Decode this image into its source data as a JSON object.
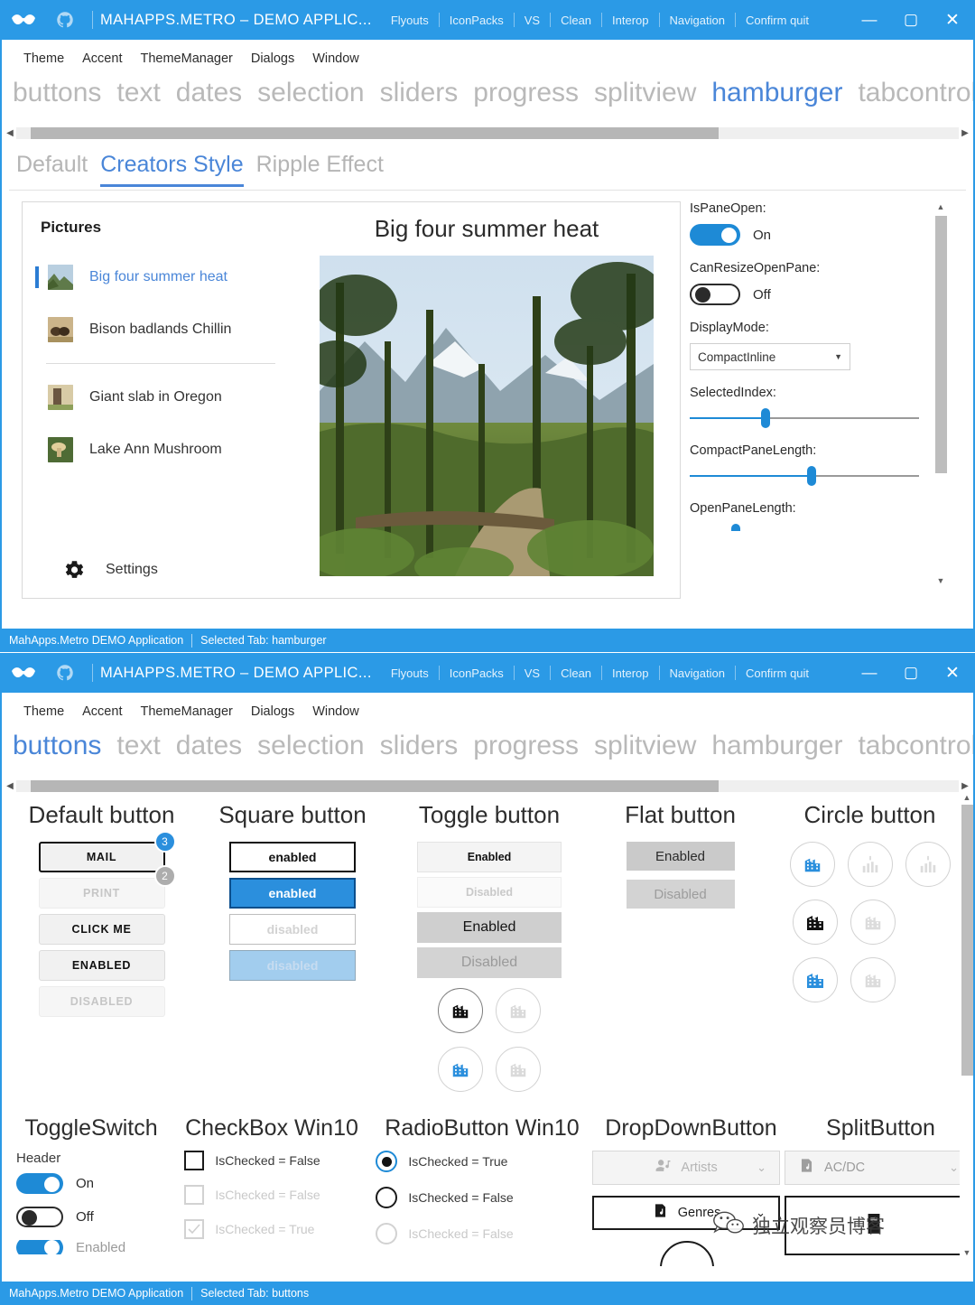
{
  "accent": "#2b9ae6",
  "accent_dark": "#2b7cd3",
  "windows": [
    {
      "titlebar": {
        "logo_icon": "mahapps-mustache-icon",
        "github_icon": "github-octocat-icon",
        "title": "MAHAPPS.METRO – DEMO APPLIC...",
        "menus": [
          "Flyouts",
          "IconPacks",
          "VS",
          "Clean",
          "Interop",
          "Navigation",
          "Confirm quit"
        ],
        "minimize": "—",
        "maximize": "▢",
        "close": "✕"
      },
      "menubar": [
        "Theme",
        "Accent",
        "ThemeManager",
        "Dialogs",
        "Window"
      ],
      "tabs": [
        {
          "label": "buttons",
          "active": false
        },
        {
          "label": "text",
          "active": false
        },
        {
          "label": "dates",
          "active": false
        },
        {
          "label": "selection",
          "active": false
        },
        {
          "label": "sliders",
          "active": false
        },
        {
          "label": "progress",
          "active": false
        },
        {
          "label": "splitview",
          "active": false
        },
        {
          "label": "hamburger",
          "active": true
        },
        {
          "label": "tabcontrol",
          "active": false
        }
      ],
      "subtabs": [
        {
          "label": "Default",
          "active": false
        },
        {
          "label": "Creators Style",
          "active": true
        },
        {
          "label": "Ripple Effect",
          "active": false
        }
      ],
      "hamburger": {
        "pane_title": "Pictures",
        "items": [
          {
            "label": "Big four summer heat",
            "active": true,
            "icon": "picture-thumbnail"
          },
          {
            "label": "Bison badlands Chillin",
            "active": false,
            "icon": "picture-thumbnail"
          },
          {
            "label": "Giant slab in Oregon",
            "active": false,
            "icon": "picture-thumbnail"
          },
          {
            "label": "Lake Ann Mushroom",
            "active": false,
            "icon": "picture-thumbnail"
          }
        ],
        "settings_label": "Settings",
        "settings_icon": "gear-icon",
        "content_title": "Big four summer heat",
        "photo_alt": "forest-mountain-photo"
      },
      "options": [
        {
          "label": "IsPaneOpen:",
          "type": "toggle",
          "state": "On"
        },
        {
          "label": "CanResizeOpenPane:",
          "type": "toggle",
          "state": "Off"
        },
        {
          "label": "DisplayMode:",
          "type": "combo",
          "value": "CompactInline",
          "arrow": "▼"
        },
        {
          "label": "SelectedIndex:",
          "type": "slider",
          "percent": 33
        },
        {
          "label": "CompactPaneLength:",
          "type": "slider",
          "percent": 53
        },
        {
          "label": "OpenPaneLength:",
          "type": "slider_partial",
          "percent": 20
        }
      ],
      "scroll": {
        "up": "▲",
        "down": "▼",
        "left": "◀",
        "right": "▶"
      },
      "statusbar": {
        "app": "MahApps.Metro DEMO Application",
        "selected": "Selected Tab:  hamburger"
      }
    },
    {
      "titlebar": {
        "logo_icon": "mahapps-mustache-icon",
        "github_icon": "github-octocat-icon",
        "title": "MAHAPPS.METRO – DEMO APPLIC...",
        "menus": [
          "Flyouts",
          "IconPacks",
          "VS",
          "Clean",
          "Interop",
          "Navigation",
          "Confirm quit"
        ],
        "minimize": "—",
        "maximize": "▢",
        "close": "✕"
      },
      "menubar": [
        "Theme",
        "Accent",
        "ThemeManager",
        "Dialogs",
        "Window"
      ],
      "tabs": [
        {
          "label": "buttons",
          "active": true
        },
        {
          "label": "text",
          "active": false
        },
        {
          "label": "dates",
          "active": false
        },
        {
          "label": "selection",
          "active": false
        },
        {
          "label": "sliders",
          "active": false
        },
        {
          "label": "progress",
          "active": false
        },
        {
          "label": "splitview",
          "active": false
        },
        {
          "label": "hamburger",
          "active": false
        },
        {
          "label": "tabcontrol",
          "active": false
        }
      ],
      "buttons_demo": {
        "headings": [
          "Default button",
          "Square button",
          "Toggle button",
          "Flat button",
          "Circle button"
        ],
        "default_buttons": [
          {
            "label": "MAIL",
            "style": "focus",
            "badge": "3"
          },
          {
            "label": "PRINT",
            "style": "dis",
            "badge": "2"
          },
          {
            "label": "CLICK ME",
            "style": "def"
          },
          {
            "label": "ENABLED",
            "style": "def"
          },
          {
            "label": "DISABLED",
            "style": "dis"
          }
        ],
        "square_buttons": [
          {
            "label": "enabled",
            "style": "sq-a"
          },
          {
            "label": "enabled",
            "style": "sq-b"
          },
          {
            "label": "disabled",
            "style": "sq-c"
          },
          {
            "label": "disabled",
            "style": "sq-d"
          }
        ],
        "toggle_buttons": [
          {
            "label": "Enabled",
            "style": "tg-a"
          },
          {
            "label": "Disabled",
            "style": "tg-b"
          },
          {
            "label": "Enabled",
            "style": "tg-c"
          },
          {
            "label": "Disabled",
            "style": "tg-d"
          }
        ],
        "toggle_circles": [
          {
            "icon": "city-icon",
            "state": "dark"
          },
          {
            "icon": "city-icon",
            "state": "light"
          },
          {
            "icon": "city-icon",
            "state": "blue"
          },
          {
            "icon": "city-icon",
            "state": "light"
          }
        ],
        "flat_buttons": [
          {
            "label": "Enabled",
            "style": "flat"
          },
          {
            "label": "Disabled",
            "style": "flat-dis"
          }
        ],
        "circle_buttons": [
          {
            "icon": "city-icon",
            "state": "blue"
          },
          {
            "icon": "chart-icon",
            "state": "light"
          },
          {
            "icon": "chart-icon",
            "state": "light"
          },
          {
            "icon": "city-icon",
            "state": "dark"
          },
          {
            "icon": "city-icon",
            "state": "light"
          },
          {
            "icon": "city-icon",
            "state": "blue"
          },
          {
            "icon": "city-icon",
            "state": "light"
          }
        ]
      },
      "controls_demo": {
        "headings": [
          "ToggleSwitch",
          "CheckBox Win10",
          "RadioButton Win10",
          "DropDownButton",
          "SplitButton"
        ],
        "toggleswitch": {
          "header": "Header",
          "switches": [
            {
              "state": "On",
              "on": true,
              "dim": false
            },
            {
              "state": "Off",
              "on": false,
              "dim": false
            },
            {
              "state": "Enabled",
              "on": true,
              "dim": false
            }
          ]
        },
        "checkboxes": [
          {
            "label": "IsChecked = False",
            "checked": false,
            "dim": false
          },
          {
            "label": "IsChecked = False",
            "checked": false,
            "dim": true
          },
          {
            "label": "IsChecked = True",
            "checked": true,
            "dim": true
          }
        ],
        "radiobuttons": [
          {
            "label": "IsChecked = True",
            "checked": true,
            "dim": false
          },
          {
            "label": "IsChecked = False",
            "checked": false,
            "dim": false
          },
          {
            "label": "IsChecked = False",
            "checked": false,
            "dim": true
          }
        ],
        "dropdownbuttons": [
          {
            "label": "Artists",
            "icon": "artist-icon",
            "style": "a",
            "chev": "⌄"
          },
          {
            "label": "Genres",
            "icon": "album-icon",
            "style": "b",
            "chev": "⌄"
          }
        ],
        "splitbuttons": [
          {
            "label": "AC/DC",
            "icon": "album-icon",
            "style": "a",
            "chev": "⌄"
          },
          {
            "label": "",
            "icon": "book-icon",
            "style": "b",
            "chev": "⌄"
          }
        ]
      },
      "statusbar": {
        "app": "MahApps.Metro DEMO Application",
        "selected": "Selected Tab:  buttons"
      }
    }
  ],
  "watermark": {
    "text": "独立观察员博客",
    "icon": "wechat-icon"
  }
}
